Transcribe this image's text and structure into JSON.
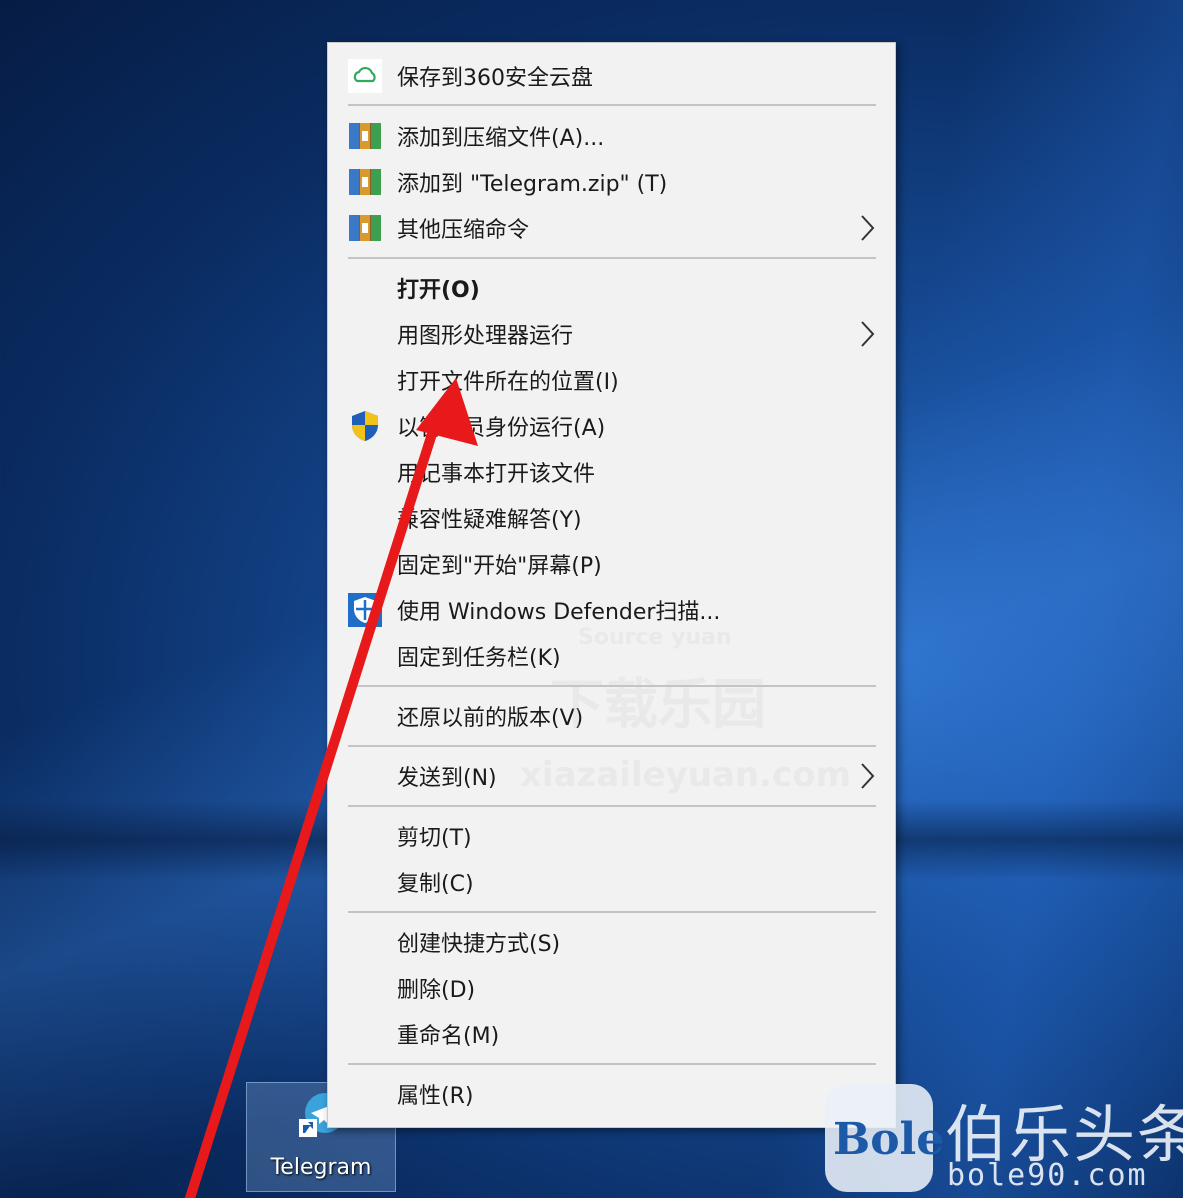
{
  "desktop": {
    "icon_label": "Telegram"
  },
  "context_menu": {
    "items": [
      {
        "label": "保存到360安全云盘",
        "icon": "cloud-icon",
        "submenu": false
      },
      {
        "label": "添加到压缩文件(A)...",
        "icon": "archive-icon",
        "submenu": false
      },
      {
        "label": "添加到 \"Telegram.zip\" (T)",
        "icon": "archive-icon",
        "submenu": false
      },
      {
        "label": "其他压缩命令",
        "icon": "archive-icon",
        "submenu": true
      },
      {
        "label": "打开(O)",
        "bold": true,
        "submenu": false
      },
      {
        "label": "用图形处理器运行",
        "submenu": true
      },
      {
        "label": "打开文件所在的位置(I)",
        "submenu": false
      },
      {
        "label": "以管理员身份运行(A)",
        "icon": "uac-shield-icon",
        "submenu": false
      },
      {
        "label": "用记事本打开该文件",
        "submenu": false
      },
      {
        "label": "兼容性疑难解答(Y)",
        "submenu": false
      },
      {
        "label": "固定到\"开始\"屏幕(P)",
        "submenu": false
      },
      {
        "label": "使用 Windows Defender扫描...",
        "icon": "defender-icon",
        "submenu": false
      },
      {
        "label": "固定到任务栏(K)",
        "submenu": false
      },
      {
        "label": "还原以前的版本(V)",
        "submenu": false
      },
      {
        "label": "发送到(N)",
        "submenu": true
      },
      {
        "label": "剪切(T)",
        "submenu": false
      },
      {
        "label": "复制(C)",
        "submenu": false
      },
      {
        "label": "创建快捷方式(S)",
        "submenu": false
      },
      {
        "label": "删除(D)",
        "submenu": false
      },
      {
        "label": "重命名(M)",
        "submenu": false
      },
      {
        "label": "属性(R)",
        "submenu": false
      }
    ]
  },
  "watermarks": {
    "site_mark_1": "Source yuan",
    "site_mark_2": "下载乐园",
    "site_mark_3": "xiazaileyuan.com",
    "brand_logo": "Bole",
    "brand_name": "伯乐头条",
    "brand_url": "bole90.com"
  },
  "colors": {
    "menu_background": "#f2f2f2",
    "annotation_arrow": "#e8191a",
    "desktop_blue": "#164a94"
  }
}
